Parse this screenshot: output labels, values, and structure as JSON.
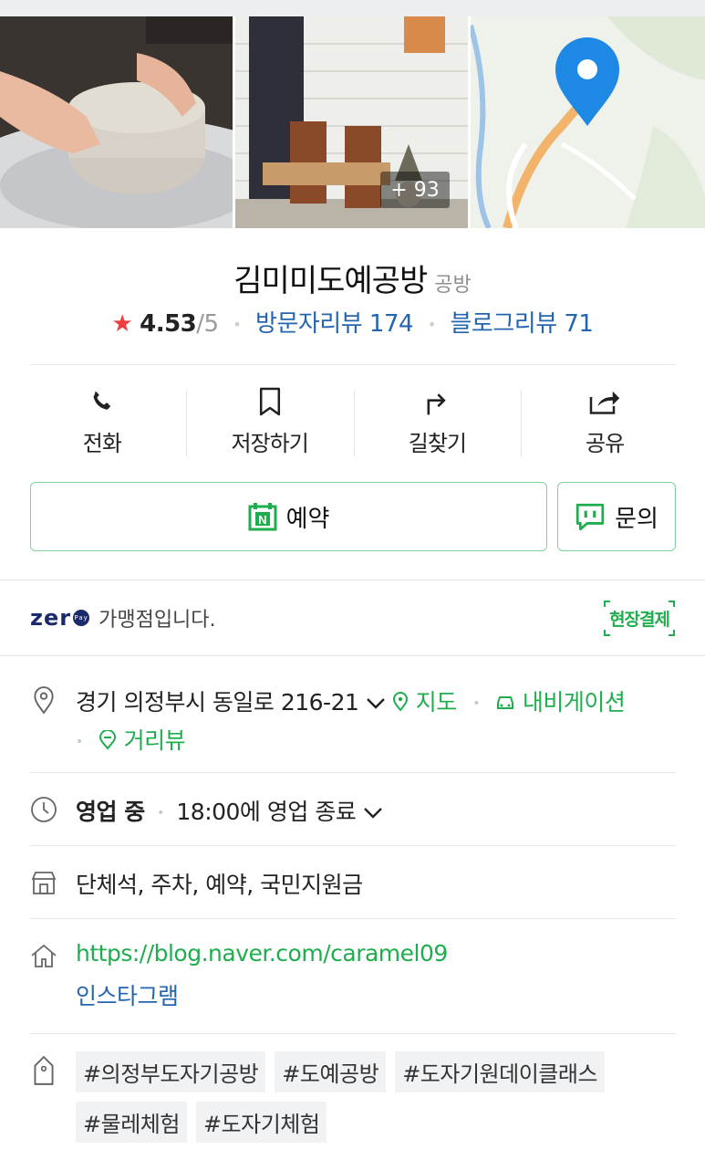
{
  "gallery": {
    "more_count": "+ 93"
  },
  "place": {
    "name": "김미미도예공방",
    "category": "공방",
    "rating": "4.53",
    "rating_max": "/5",
    "visitor_review_label": "방문자리뷰 174",
    "blog_review_label": "블로그리뷰 71"
  },
  "actions": {
    "call": "전화",
    "save": "저장하기",
    "directions": "길찾기",
    "share": "공유"
  },
  "buttons": {
    "reserve": "예약",
    "inquiry": "문의"
  },
  "zeropay": {
    "logo": "zer",
    "logo_badge": "Pay",
    "text": "가맹점입니다.",
    "onsite_pay": "현장결제"
  },
  "address": {
    "text": "경기 의정부시 동일로 216-21",
    "map": "지도",
    "navigation": "내비게이션",
    "street_view": "거리뷰"
  },
  "hours": {
    "status": "영업 중",
    "close_info": "18:00에 영업 종료"
  },
  "amenities": {
    "text": "단체석, 주차, 예약, 국민지원금"
  },
  "links": {
    "homepage": "https://blog.naver.com/caramel09",
    "instagram": "인스타그램"
  },
  "tags": [
    "#의정부도자기공방",
    "#도예공방",
    "#도자기원데이클래스",
    "#물레체험",
    "#도자기체험"
  ],
  "colors": {
    "accent_green": "#1fae4e",
    "link_blue": "#2465b0",
    "star_red": "#f03c3c",
    "map_pin_blue": "#1e88e5"
  }
}
